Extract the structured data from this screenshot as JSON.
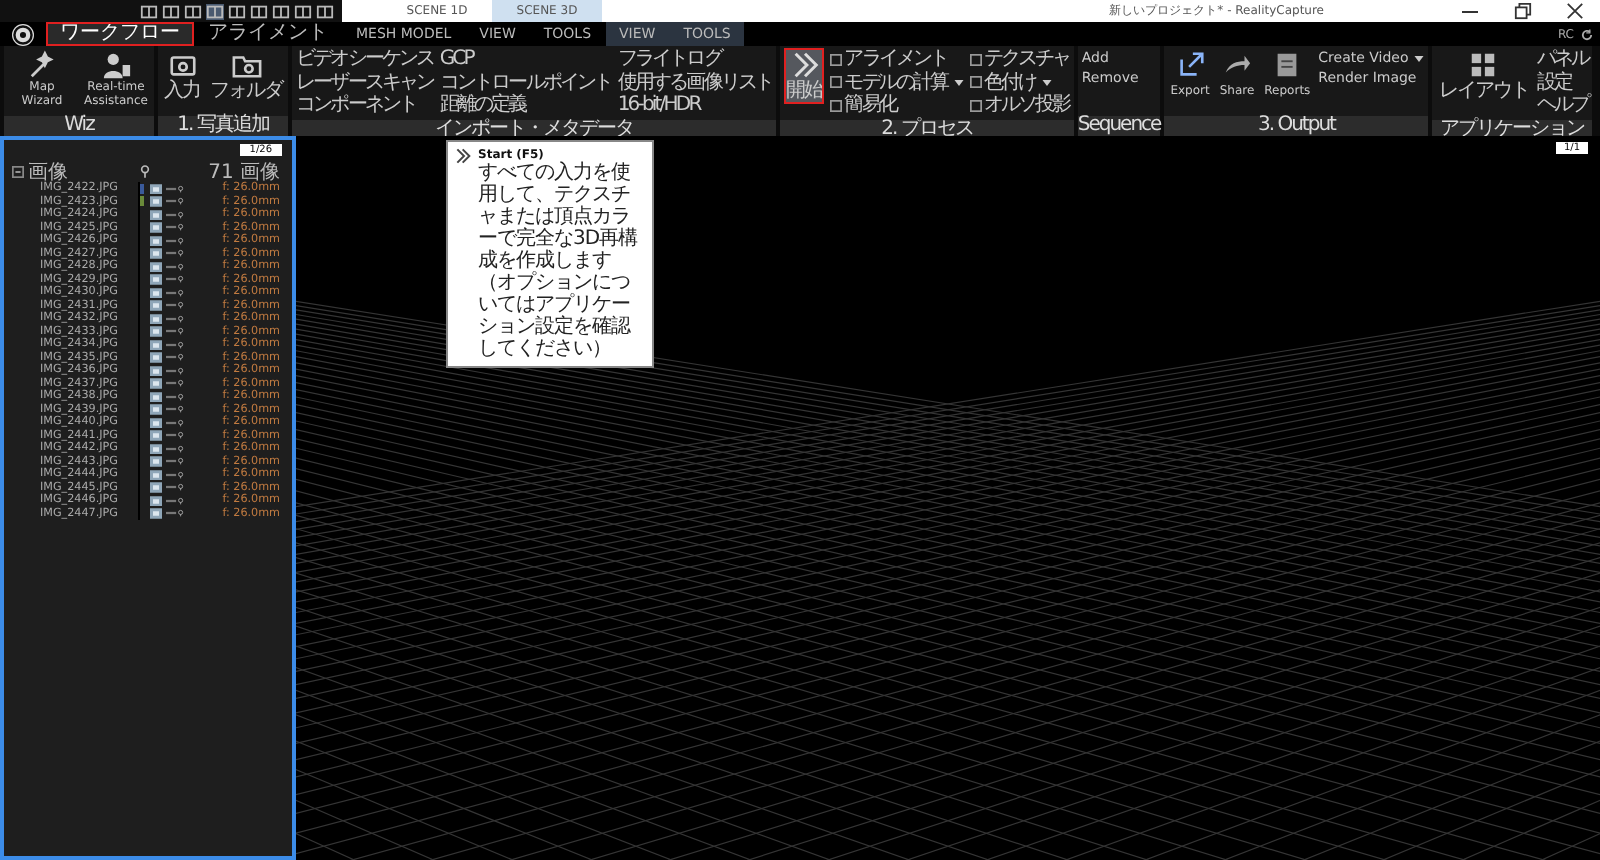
{
  "title_bar": {
    "scene_tabs": [
      {
        "label": "SCENE 1D",
        "selected": false
      },
      {
        "label": "SCENE 3D",
        "selected": true
      }
    ],
    "title": "新しいプロジェクト* - RealityCapture"
  },
  "ribbon_tabs": [
    {
      "label": "ワークフロー",
      "selected": true,
      "highlighted": true,
      "contextual": false
    },
    {
      "label": "アライメント",
      "selected": false,
      "highlighted": false,
      "contextual": false
    },
    {
      "label": "MESH MODEL",
      "selected": false,
      "highlighted": false,
      "contextual": false
    },
    {
      "label": "VIEW",
      "selected": false,
      "highlighted": false,
      "contextual": false
    },
    {
      "label": "TOOLS",
      "selected": false,
      "highlighted": false,
      "contextual": false
    },
    {
      "label": "VIEW",
      "selected": false,
      "highlighted": false,
      "contextual": true
    },
    {
      "label": "TOOLS",
      "selected": false,
      "highlighted": false,
      "contextual": true
    }
  ],
  "user_label": "RC",
  "ribbon_groups": [
    {
      "label": "Wiz",
      "columns": [
        [
          {
            "kind": "large",
            "label": "Map Wizard",
            "highlighted": false
          }
        ],
        [
          {
            "kind": "large",
            "label": "Real-time Assistance",
            "highlighted": false
          }
        ]
      ]
    },
    {
      "label": "1. 写真追加",
      "columns": [
        [
          {
            "kind": "large",
            "label": "入力",
            "highlighted": false
          }
        ],
        [
          {
            "kind": "large",
            "label": "フォルダ",
            "highlighted": false
          }
        ]
      ]
    },
    {
      "label": "インポート・メタデータ",
      "columns": [
        [
          {
            "kind": "text",
            "label": "ビデオシーケンス"
          },
          {
            "kind": "text",
            "label": "レーザースキャン"
          },
          {
            "kind": "text",
            "label": "コンポーネント"
          }
        ],
        [
          {
            "kind": "text",
            "label": "GCP"
          },
          {
            "kind": "text",
            "label": "コントロールポイント"
          },
          {
            "kind": "text",
            "label": "距離の定義"
          }
        ],
        [
          {
            "kind": "text",
            "label": "フライトログ"
          },
          {
            "kind": "text",
            "label": "使用する画像リスト"
          },
          {
            "kind": "text",
            "label": "16-bit/HDR"
          }
        ]
      ]
    },
    {
      "label": "2. プロセス",
      "columns": [
        [
          {
            "kind": "large",
            "label": "開始",
            "highlighted": true
          }
        ],
        [
          {
            "kind": "small",
            "label": "アライメント",
            "dropdown": false
          },
          {
            "kind": "small",
            "label": "モデルの計算",
            "dropdown": true
          },
          {
            "kind": "small",
            "label": "簡易化",
            "dropdown": false
          }
        ],
        [
          {
            "kind": "small",
            "label": "テクスチャ",
            "dropdown": false
          },
          {
            "kind": "small",
            "label": "色付け",
            "dropdown": true
          },
          {
            "kind": "small",
            "label": "オルソ投影",
            "dropdown": false
          }
        ]
      ]
    },
    {
      "label": "Sequence",
      "columns": [
        [
          {
            "kind": "text",
            "label": "Add"
          },
          {
            "kind": "text",
            "label": "Remove"
          }
        ]
      ]
    },
    {
      "label": "3. Output",
      "columns": [
        [
          {
            "kind": "large",
            "label": "Export",
            "highlighted": false
          }
        ],
        [
          {
            "kind": "large",
            "label": "Share",
            "highlighted": false
          }
        ],
        [
          {
            "kind": "large",
            "label": "Reports",
            "highlighted": false
          }
        ],
        [
          {
            "kind": "text",
            "label": "Create Video",
            "dropdown": true
          },
          {
            "kind": "text",
            "label": "Render Image",
            "dropdown": false
          }
        ]
      ]
    },
    {
      "label": "アプリケーション",
      "columns": [
        [
          {
            "kind": "large",
            "label": "レイアウト",
            "highlighted": false
          }
        ],
        [
          {
            "kind": "text",
            "label": "パネル"
          },
          {
            "kind": "text",
            "label": "設定"
          },
          {
            "kind": "text",
            "label": "ヘルプ"
          }
        ]
      ]
    }
  ],
  "tooltip": {
    "title": "Start (F5)",
    "text": "すべての入力を使用して、テクスチャまたは頂点カラーで完全な3D再構成を作成します（オプションについてはアプリケーション設定を確認してください）"
  },
  "images_panel": {
    "badge": "1/26",
    "count": "71 画像",
    "tree": {
      "label": "画像",
      "expanded": true,
      "children": [
        {
          "label": "IMG_2422.JPG",
          "focal": "f: 26.0mm",
          "color": "#3a5a9a"
        },
        {
          "label": "IMG_2423.JPG",
          "focal": "f: 26.0mm",
          "color": "#6a8a3a"
        },
        {
          "label": "IMG_2424.JPG",
          "focal": "f: 26.0mm"
        },
        {
          "label": "IMG_2425.JPG",
          "focal": "f: 26.0mm"
        },
        {
          "label": "IMG_2426.JPG",
          "focal": "f: 26.0mm"
        },
        {
          "label": "IMG_2427.JPG",
          "focal": "f: 26.0mm"
        },
        {
          "label": "IMG_2428.JPG",
          "focal": "f: 26.0mm"
        },
        {
          "label": "IMG_2429.JPG",
          "focal": "f: 26.0mm"
        },
        {
          "label": "IMG_2430.JPG",
          "focal": "f: 26.0mm"
        },
        {
          "label": "IMG_2431.JPG",
          "focal": "f: 26.0mm"
        },
        {
          "label": "IMG_2432.JPG",
          "focal": "f: 26.0mm"
        },
        {
          "label": "IMG_2433.JPG",
          "focal": "f: 26.0mm"
        },
        {
          "label": "IMG_2434.JPG",
          "focal": "f: 26.0mm"
        },
        {
          "label": "IMG_2435.JPG",
          "focal": "f: 26.0mm"
        },
        {
          "label": "IMG_2436.JPG",
          "focal": "f: 26.0mm"
        },
        {
          "label": "IMG_2437.JPG",
          "focal": "f: 26.0mm"
        },
        {
          "label": "IMG_2438.JPG",
          "focal": "f: 26.0mm"
        },
        {
          "label": "IMG_2439.JPG",
          "focal": "f: 26.0mm"
        },
        {
          "label": "IMG_2440.JPG",
          "focal": "f: 26.0mm"
        },
        {
          "label": "IMG_2441.JPG",
          "focal": "f: 26.0mm"
        },
        {
          "label": "IMG_2442.JPG",
          "focal": "f: 26.0mm"
        },
        {
          "label": "IMG_2443.JPG",
          "focal": "f: 26.0mm"
        },
        {
          "label": "IMG_2444.JPG",
          "focal": "f: 26.0mm"
        },
        {
          "label": "IMG_2445.JPG",
          "focal": "f: 26.0mm"
        },
        {
          "label": "IMG_2446.JPG",
          "focal": "f: 26.0mm"
        },
        {
          "label": "IMG_2447.JPG",
          "focal": "f: 26.0mm"
        }
      ]
    }
  },
  "viewport": {
    "badge": "1/1"
  }
}
